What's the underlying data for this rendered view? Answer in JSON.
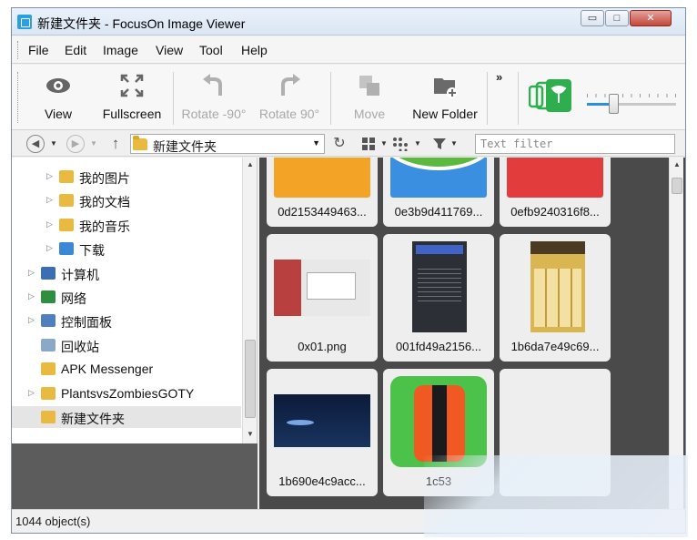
{
  "window": {
    "title": "新建文件夹 - FocusOn Image Viewer",
    "min_glyph": "▭",
    "max_glyph": "□",
    "close_glyph": "✕"
  },
  "menu": [
    "File",
    "Edit",
    "Image",
    "View",
    "Tool",
    "Help"
  ],
  "toolbar": {
    "view": "View",
    "fullscreen": "Fullscreen",
    "rotate_left": "Rotate -90°",
    "rotate_right": "Rotate 90°",
    "move": "Move",
    "new_folder": "New Folder",
    "overflow": "»",
    "zoom_level": 0.3
  },
  "address": {
    "path": "新建文件夹",
    "filter_placeholder": "Text filter"
  },
  "tree": [
    {
      "label": "我的图片",
      "icon": "pictures-folder-icon",
      "color": "#e9b940"
    },
    {
      "label": "我的文档",
      "icon": "documents-folder-icon",
      "color": "#e9b940"
    },
    {
      "label": "我的音乐",
      "icon": "music-folder-icon",
      "color": "#e9b940"
    },
    {
      "label": "下载",
      "icon": "downloads-folder-icon",
      "color": "#3b88d8"
    },
    {
      "label": "计算机",
      "icon": "computer-icon",
      "color": "#3a6fb5"
    },
    {
      "label": "网络",
      "icon": "network-icon",
      "color": "#2e8f3e"
    },
    {
      "label": "控制面板",
      "icon": "control-panel-icon",
      "color": "#4f7fc0"
    },
    {
      "label": "回收站",
      "icon": "recycle-bin-icon",
      "color": "#8aa8c8"
    },
    {
      "label": "APK Messenger",
      "icon": "folder-icon",
      "color": "#e9b940"
    },
    {
      "label": "PlantsvsZombiesGOTY",
      "icon": "folder-icon",
      "color": "#e9b940"
    },
    {
      "label": "新建文件夹",
      "icon": "folder-icon",
      "color": "#e9b940"
    }
  ],
  "thumbnails": [
    {
      "name": "0d2153449463..."
    },
    {
      "name": "0e3b9d411769..."
    },
    {
      "name": "0efb9240316f8..."
    },
    {
      "name": "0x01.png"
    },
    {
      "name": "001fd49a2156..."
    },
    {
      "name": "1b6da7e49c69..."
    },
    {
      "name": "1b690e4c9acc..."
    },
    {
      "name": "1c53"
    },
    {
      "name": ""
    }
  ],
  "status": {
    "count": "1044 object(s)"
  },
  "colors": {
    "accent": "#2a8fe0",
    "green_logo": "#2fae4e",
    "thumb_bg": "#4a4a4a"
  }
}
